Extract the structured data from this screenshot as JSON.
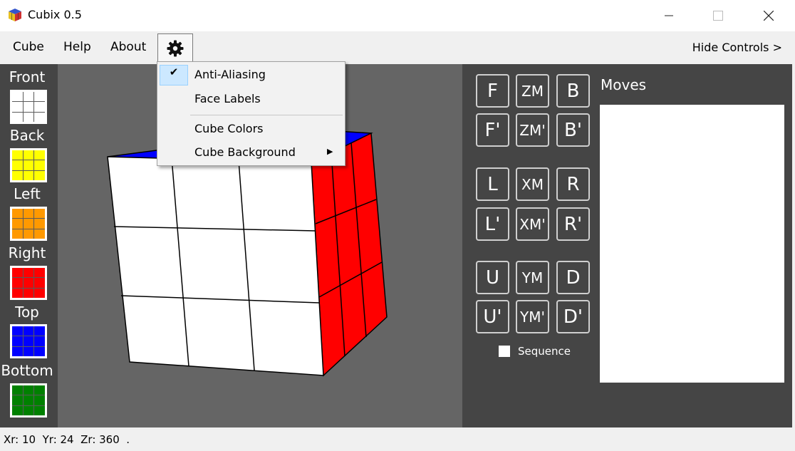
{
  "window": {
    "title": "Cubix 0.5",
    "icons": [
      "app-cube-icon",
      "minimize-icon",
      "maximize-icon",
      "close-icon"
    ]
  },
  "menubar": {
    "items": [
      "Cube",
      "Help",
      "About"
    ],
    "settings_icon": "gear-icon",
    "hide_controls": "Hide Controls >"
  },
  "settings_menu": {
    "anti_aliasing": "Anti-Aliasing",
    "anti_aliasing_checked": true,
    "face_labels": "Face Labels",
    "cube_colors": "Cube Colors",
    "cube_background": "Cube Background",
    "submenu_icon": "submenu-arrow-icon"
  },
  "faces": [
    {
      "label": "Front",
      "color": "#ffffff"
    },
    {
      "label": "Back",
      "color": "#ffff00"
    },
    {
      "label": "Left",
      "color": "#ff9900"
    },
    {
      "label": "Right",
      "color": "#ff0000"
    },
    {
      "label": "Top",
      "color": "#0000ff"
    },
    {
      "label": "Bottom",
      "color": "#008000"
    }
  ],
  "controls": {
    "rows": [
      [
        "F",
        "ZM",
        "B"
      ],
      [
        "F'",
        "ZM'",
        "B'"
      ],
      [
        "L",
        "XM",
        "R"
      ],
      [
        "L'",
        "XM'",
        "R'"
      ],
      [
        "U",
        "YM",
        "D"
      ],
      [
        "U'",
        "YM'",
        "D'"
      ]
    ],
    "sequence_label": "Sequence",
    "sequence_checked": false,
    "moves_label": "Moves"
  },
  "viewport": {
    "background": "#656565",
    "visible_faces": {
      "front": "#ffffff",
      "right": "#ff0000",
      "top": "#0000ff"
    }
  },
  "status": {
    "text": "Xr: 10  Yr: 24  Zr: 360  ."
  }
}
